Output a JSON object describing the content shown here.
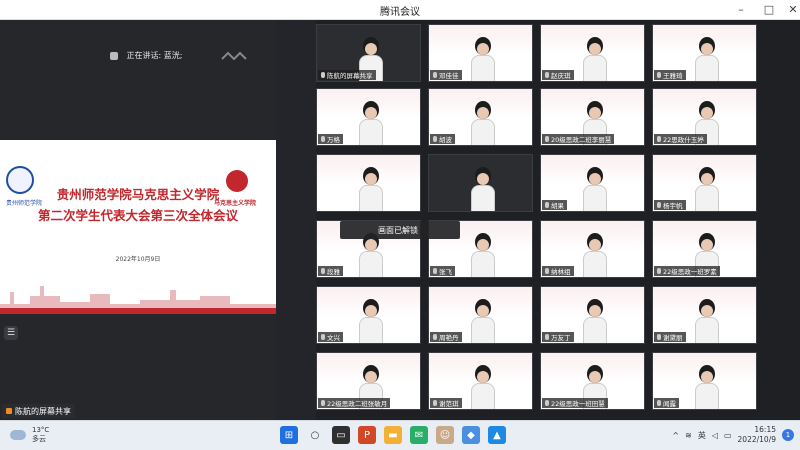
{
  "window": {
    "title": "腾讯会议",
    "controls": [
      "–",
      "□",
      "✕"
    ]
  },
  "left_pane": {
    "speaking_label": "正在讲话: 蓝洸;",
    "slide": {
      "logo_left_text": "贵州师范学院",
      "logo_right_text": "马克思主义学院",
      "title_line1": "贵州师范学院马克思主义学院",
      "title_line2": "第二次学生代表大会第三次全体会议",
      "date": "2022年10月9日"
    },
    "share_badge": "陈航的屏幕共享"
  },
  "tiles": [
    {
      "name": "陈航的屏幕共享",
      "kind": "dark"
    },
    {
      "name": "邓佳佳",
      "kind": "poster"
    },
    {
      "name": "赵庆琪",
      "kind": "poster"
    },
    {
      "name": "王雅琦",
      "kind": "poster"
    },
    {
      "name": "万格",
      "kind": "poster"
    },
    {
      "name": "胡波",
      "kind": "poster"
    },
    {
      "name": "20级思政二班李丽慧",
      "kind": "poster"
    },
    {
      "name": "22思政什玉婷",
      "kind": "poster"
    },
    {
      "name": "",
      "kind": "poster"
    },
    {
      "name": "",
      "kind": "dark"
    },
    {
      "name": "胡果",
      "kind": "poster"
    },
    {
      "name": "杨宇帆",
      "kind": "poster"
    },
    {
      "name": "段雅",
      "kind": "poster"
    },
    {
      "name": "张飞",
      "kind": "poster"
    },
    {
      "name": "纳林组",
      "kind": "poster"
    },
    {
      "name": "22级思政一班罗素",
      "kind": "poster"
    },
    {
      "name": "文兴",
      "kind": "poster"
    },
    {
      "name": "周艳丹",
      "kind": "poster"
    },
    {
      "name": "万友丁",
      "kind": "poster"
    },
    {
      "name": "谢黛丽",
      "kind": "poster"
    },
    {
      "name": "22级思政二班张敏月",
      "kind": "poster"
    },
    {
      "name": "谢范琪",
      "kind": "poster"
    },
    {
      "name": "22级思政一班田慧",
      "kind": "poster"
    },
    {
      "name": "闻露",
      "kind": "poster"
    }
  ],
  "toast": "画面已解锁",
  "taskbar": {
    "weather_temp": "13°C",
    "weather_desc": "多云",
    "ime": "英",
    "time": "16:15",
    "date": "2022/10/9",
    "notification_count": "1"
  }
}
